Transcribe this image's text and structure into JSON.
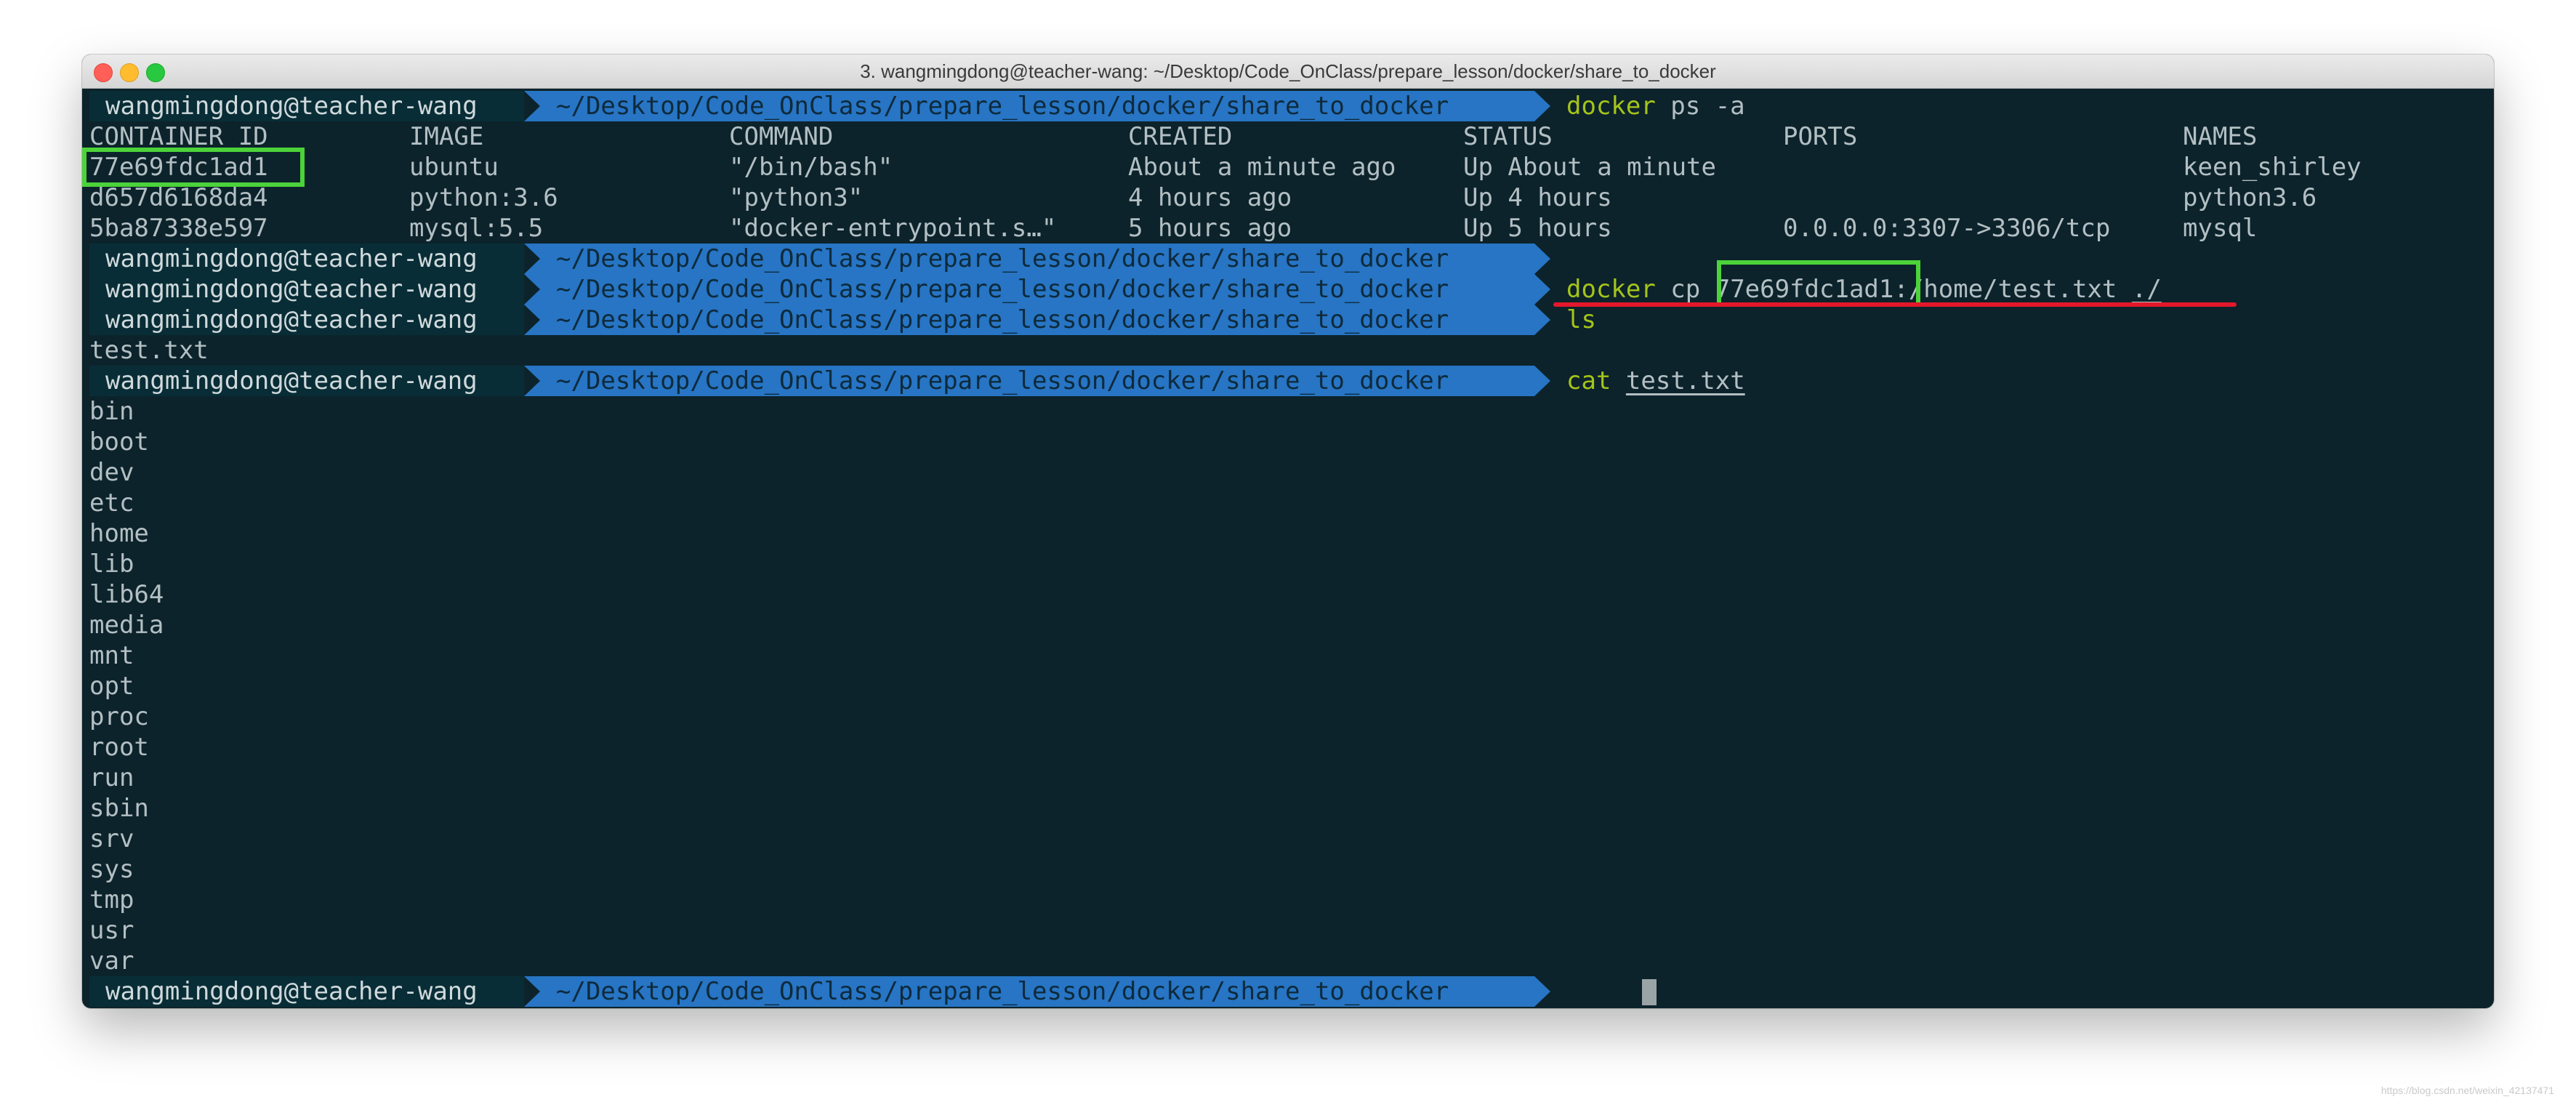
{
  "window": {
    "title": "3. wangmingdong@teacher-wang: ~/Desktop/Code_OnClass/prepare_lesson/docker/share_to_docker"
  },
  "prompt": {
    "user": "wangmingdong@teacher-wang",
    "path": "~/Desktop/Code_OnClass/prepare_lesson/docker/share_to_docker"
  },
  "commands": {
    "ps": {
      "cmd": "docker",
      "args": " ps -a"
    },
    "cp": {
      "cmd": "docker",
      "args_before_id": " cp ",
      "id": "77e69fdc1ad1",
      "args_after_id": ":/home/test.txt ",
      "dest": "./"
    },
    "ls": {
      "cmd": "ls"
    },
    "cat": {
      "cmd": "cat",
      "file": "test.txt"
    }
  },
  "ps_table": {
    "headers": [
      "CONTAINER ID",
      "IMAGE",
      "COMMAND",
      "CREATED",
      "STATUS",
      "PORTS",
      "NAMES"
    ],
    "rows": [
      [
        "77e69fdc1ad1",
        "ubuntu",
        "\"/bin/bash\"",
        "About a minute ago",
        "Up About a minute",
        "",
        "keen_shirley"
      ],
      [
        "d657d6168da4",
        "python:3.6",
        "\"python3\"",
        "4 hours ago",
        "Up 4 hours",
        "",
        "python3.6"
      ],
      [
        "5ba87338e597",
        "mysql:5.5",
        "\"docker-entrypoint.s…\"",
        "5 hours ago",
        "Up 5 hours",
        "0.0.0.0:3307->3306/tcp",
        "mysql"
      ]
    ]
  },
  "ls_output": [
    "test.txt"
  ],
  "cat_output": [
    "bin",
    "boot",
    "dev",
    "etc",
    "home",
    "lib",
    "lib64",
    "media",
    "mnt",
    "opt",
    "proc",
    "root",
    "run",
    "sbin",
    "srv",
    "sys",
    "tmp",
    "usr",
    "var"
  ],
  "colors": {
    "terminal_bg": "#0c232b",
    "prompt_user_bg": "#082d36",
    "prompt_path_bg": "#2775c4",
    "command_green": "#a5c41a",
    "highlight_green": "#4cd33a",
    "highlight_red": "#e4182b"
  },
  "watermark": "https://blog.csdn.net/weixin_42137471"
}
